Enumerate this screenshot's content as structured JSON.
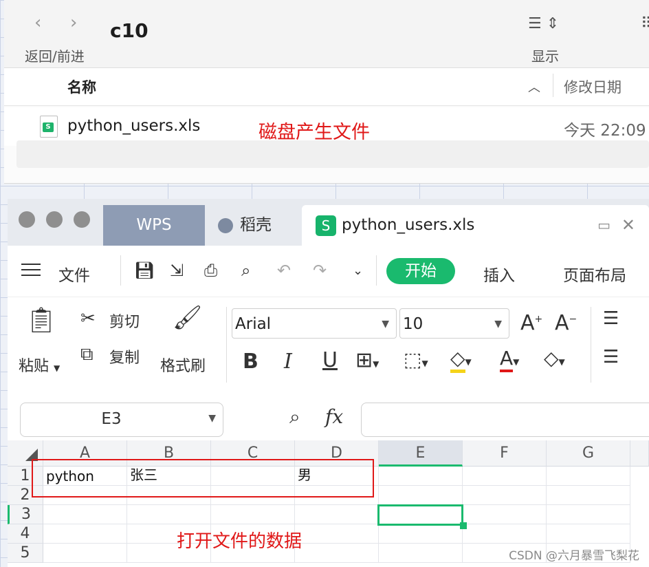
{
  "finder": {
    "title": "c10",
    "back_label": "‹",
    "forward_label": "›",
    "nav_label": "返回/前进",
    "view_label": "显示",
    "column_name": "名称",
    "column_date": "修改日期",
    "file": {
      "name": "python_users.xls",
      "date": "今天 22:09"
    },
    "annotation": "磁盘产生文件"
  },
  "wps": {
    "tabs": {
      "wps": "WPS",
      "daoke": "稻壳",
      "file": "python_users.xls"
    },
    "menu": {
      "file": "文件",
      "start": "开始",
      "insert": "插入",
      "page_layout": "页面布局"
    },
    "ribbon": {
      "paste": "粘贴",
      "cut": "剪切",
      "copy": "复制",
      "format_painter": "格式刷",
      "font_name": "Arial",
      "font_size": "10"
    },
    "formula": {
      "name_box": "E3",
      "fx_label": "fx",
      "content": ""
    },
    "sheet": {
      "columns": [
        "A",
        "B",
        "C",
        "D",
        "E",
        "F",
        "G"
      ],
      "rows": [
        "1",
        "2",
        "3",
        "4",
        "5"
      ],
      "active_column": "E",
      "active_row": "3",
      "cells": {
        "A1": "python",
        "B1": "张三",
        "D1": "男"
      },
      "annotation": "打开文件的数据"
    }
  },
  "watermark": "CSDN @六月暴雪飞梨花",
  "colors": {
    "accent_green": "#1aba6e",
    "annotation_red": "#e01818",
    "wps_tab": "#8e9cb4"
  }
}
